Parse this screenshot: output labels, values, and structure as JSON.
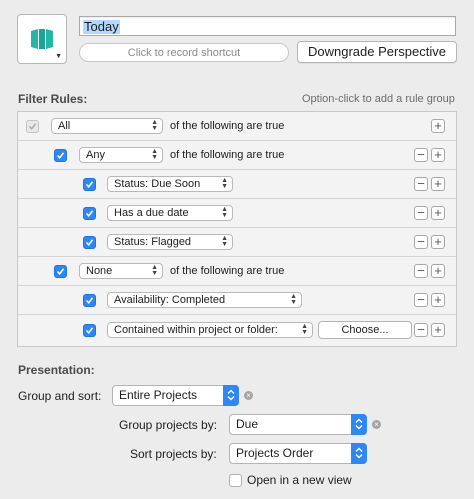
{
  "header": {
    "perspective_title": "Today",
    "record_shortcut_label": "Click to record shortcut",
    "downgrade_label": "Downgrade Perspective",
    "icon_name": "perspective-glyph-icon",
    "icon_color": "#22b7a6"
  },
  "filter_rules": {
    "heading": "Filter Rules:",
    "hint": "Option-click to add a rule group",
    "rows": [
      {
        "quantifier": "All",
        "suffix": "of the following are true"
      },
      {
        "quantifier": "Any",
        "suffix": "of the following are true"
      },
      {
        "rule": "Status: Due Soon"
      },
      {
        "rule": "Has a due date"
      },
      {
        "rule": "Status: Flagged"
      },
      {
        "quantifier": "None",
        "suffix": "of the following are true"
      },
      {
        "rule": "Availability: Completed"
      },
      {
        "rule": "Contained within project or folder:",
        "button": "Choose..."
      }
    ],
    "minus_glyph": "−",
    "plus_glyph": "+"
  },
  "presentation": {
    "heading": "Presentation:",
    "group_and_sort_label": "Group and sort:",
    "group_and_sort_value": "Entire Projects",
    "group_projects_label": "Group projects by:",
    "group_projects_value": "Due",
    "sort_projects_label": "Sort projects by:",
    "sort_projects_value": "Projects Order",
    "open_new_view_label": "Open in a new view",
    "open_new_view_checked": false,
    "clear_glyph": "×"
  },
  "colors": {
    "accent": "#2f86f5",
    "background": "#ececec"
  }
}
